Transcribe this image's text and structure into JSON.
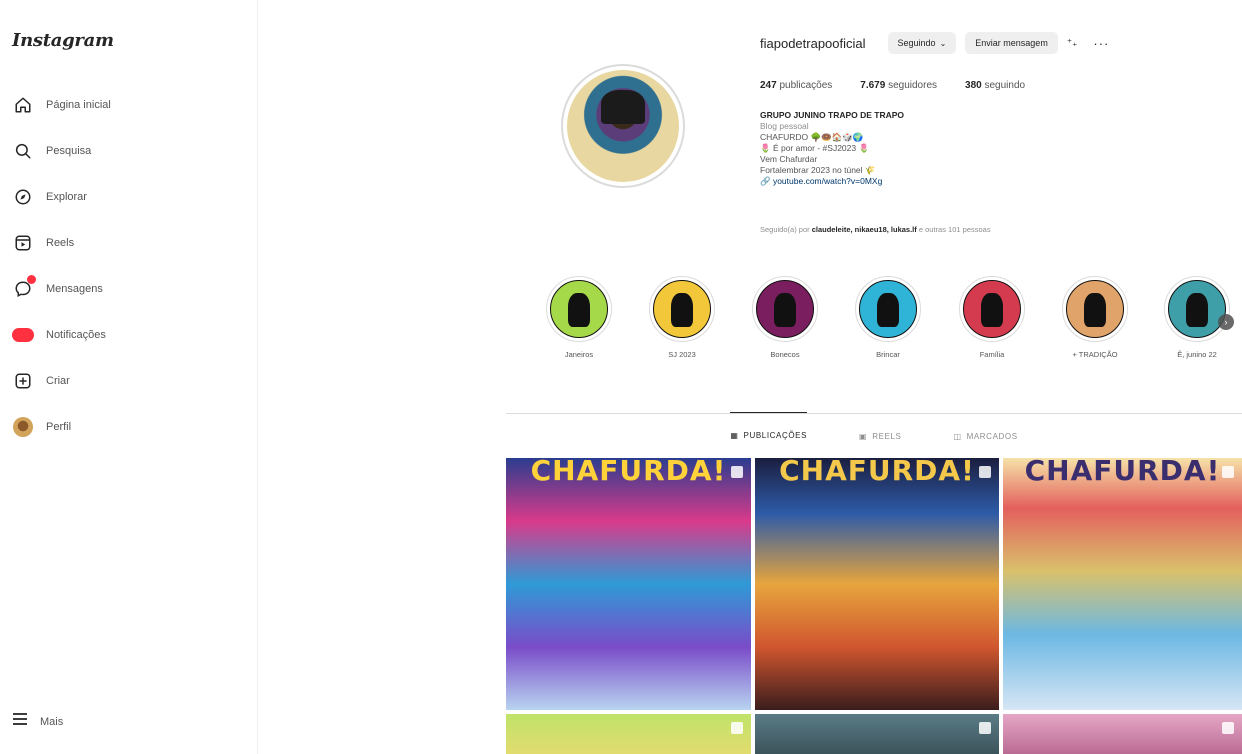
{
  "sidebar": {
    "logo": "Instagram",
    "items": [
      {
        "label": "Página inicial",
        "icon": "home-icon"
      },
      {
        "label": "Pesquisa",
        "icon": "search-icon"
      },
      {
        "label": "Explorar",
        "icon": "compass-icon"
      },
      {
        "label": "Reels",
        "icon": "reels-icon"
      },
      {
        "label": "Mensagens",
        "icon": "messenger-icon"
      },
      {
        "label": "Notificações",
        "icon": "heart-icon"
      },
      {
        "label": "Criar",
        "icon": "plus-square-icon"
      },
      {
        "label": "Perfil",
        "icon": "profile-avatar-icon"
      }
    ],
    "more_label": "Mais"
  },
  "profile": {
    "username": "fiapodetrapooficial",
    "following_button": "Seguindo",
    "message_button": "Enviar mensagem",
    "posts_count": "247",
    "posts_label": "publicações",
    "followers_count": "7.679",
    "followers_label": "seguidores",
    "following_count": "380",
    "following_label": "seguindo",
    "bio": {
      "name": "GRUPO JUNINO TRAPO DE TRAPO",
      "category": "Blog pessoal",
      "line1": "CHAFURDO 🌳🍩🏠🎲🌍",
      "line2": "🌷 É por amor - #SJ2023 🌷",
      "line3": "Vem Chafurdar",
      "line4": "Fortalembrar 2023 no túnel 🌾",
      "link": "youtube.com/watch?v=0MXg"
    },
    "followed_by_prefix": "Seguido(a) por",
    "followed_by_names": "claudeleite, nikaeu18, lukas.lf",
    "followed_by_suffix": "e outras 101 pessoas"
  },
  "highlights": [
    {
      "label": "Janeiros",
      "bg": "#a6d94a"
    },
    {
      "label": "SJ 2023",
      "bg": "#f2c83a"
    },
    {
      "label": "Bonecos",
      "bg": "#7a1e5f"
    },
    {
      "label": "Brincar",
      "bg": "#2fb3d6"
    },
    {
      "label": "Família",
      "bg": "#d43b4e"
    },
    {
      "label": "+ TRADIÇÃO",
      "bg": "#e0a36a"
    },
    {
      "label": "Ê, junino 22",
      "bg": "#3f9fa8"
    }
  ],
  "tabs": [
    {
      "label": "PUBLICAÇÕES",
      "icon": "grid-icon",
      "active": true
    },
    {
      "label": "REELS",
      "icon": "reels-icon",
      "active": false
    },
    {
      "label": "MARCADOS",
      "icon": "tag-icon",
      "active": false
    }
  ],
  "posts": [
    {
      "title": "CHAFURDA!",
      "bg": "linear-gradient(180deg,#2a3d8f 0%,#d93a8a 25%,#2f9ad6 50%,#7a4cc9 75%,#b8d4f0 100%)",
      "color": "#ffd23a"
    },
    {
      "title": "CHAFURDA!",
      "bg": "linear-gradient(180deg,#1b1e3f 0%,#2d5ba8 22%,#e7a53d 50%,#d0562f 75%,#3b1d1d 100%)",
      "color": "#f4c84a"
    },
    {
      "title": "CHAFURDA!",
      "bg": "linear-gradient(180deg,#f6e2a8 0%,#e3605d 20%,#d9c16c 45%,#6cb8e3 70%,#d6e6f5 100%)",
      "color": "#3b2e6f"
    },
    {
      "title": "",
      "bg": "linear-gradient(180deg,#bfe36a 0%,#f3d870 100%)",
      "color": "#ffffff"
    },
    {
      "title": "",
      "bg": "linear-gradient(180deg,#5a7c86 0%,#2d3f46 100%)",
      "color": "#ffffff"
    },
    {
      "title": "",
      "bg": "linear-gradient(180deg,#e5a7c6 0%,#a64d7a 100%)",
      "color": "#ffffff"
    }
  ]
}
